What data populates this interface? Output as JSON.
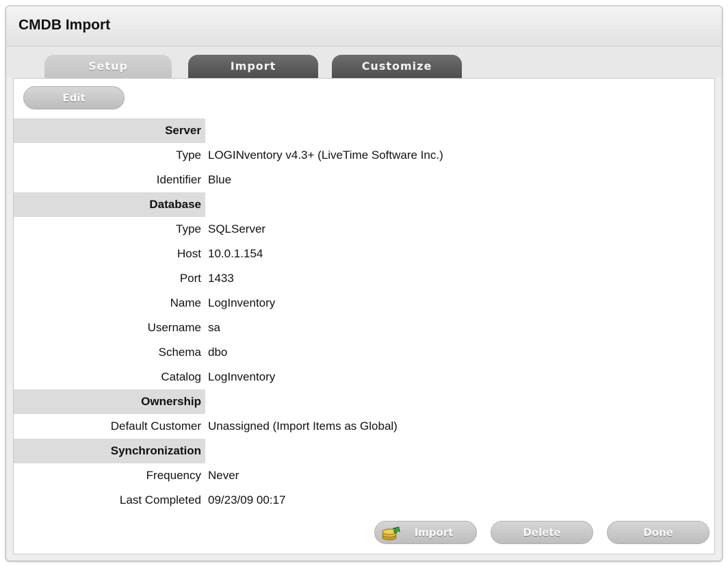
{
  "window": {
    "title": "CMDB Import"
  },
  "tabs": [
    {
      "label": "Setup",
      "active": true
    },
    {
      "label": "Import",
      "active": false
    },
    {
      "label": "Customize",
      "active": false
    }
  ],
  "toolbar": {
    "edit_label": "Edit"
  },
  "sections": {
    "server": {
      "heading": "Server",
      "rows": [
        {
          "label": "Type",
          "value": "LOGINventory v4.3+ (LiveTime Software Inc.)"
        },
        {
          "label": "Identifier",
          "value": "Blue"
        }
      ]
    },
    "database": {
      "heading": "Database",
      "rows": [
        {
          "label": "Type",
          "value": "SQLServer"
        },
        {
          "label": "Host",
          "value": "10.0.1.154"
        },
        {
          "label": "Port",
          "value": "1433"
        },
        {
          "label": "Name",
          "value": "LogInventory"
        },
        {
          "label": "Username",
          "value": "sa"
        },
        {
          "label": "Schema",
          "value": "dbo"
        },
        {
          "label": "Catalog",
          "value": "LogInventory"
        }
      ]
    },
    "ownership": {
      "heading": "Ownership",
      "rows": [
        {
          "label": "Default Customer",
          "value": "Unassigned (Import Items as Global)"
        }
      ]
    },
    "synchronization": {
      "heading": "Synchronization",
      "rows": [
        {
          "label": "Frequency",
          "value": "Never"
        },
        {
          "label": "Last Completed",
          "value": "09/23/09 00:17"
        }
      ]
    }
  },
  "footer": {
    "import_label": "Import",
    "delete_label": "Delete",
    "done_label": "Done"
  },
  "icons": {
    "import": "coins-with-green-arrow-icon"
  }
}
